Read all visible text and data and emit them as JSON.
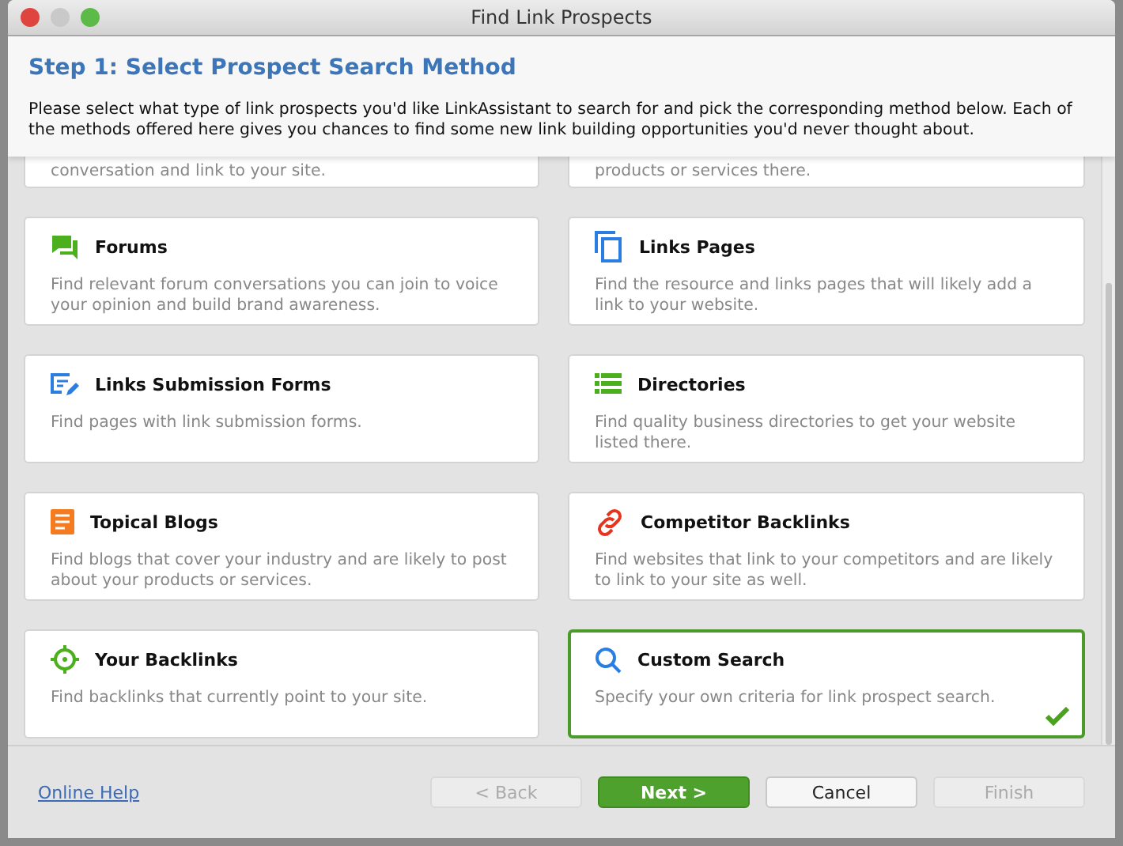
{
  "window": {
    "title": "Find Link Prospects"
  },
  "header": {
    "title": "Step 1: Select Prospect Search Method",
    "description": "Please select what type of link prospects you'd like LinkAssistant to search for and pick the corresponding method below. Each of the methods offered here gives you chances to find some new link building opportunities you'd never thought about."
  },
  "partial_cards": [
    "conversation and link to your site.",
    "products or services there."
  ],
  "methods": [
    {
      "kind": "forum",
      "title": "Forums",
      "description": "Find relevant forum conversations you can join to voice your opinion and build brand awareness.",
      "selected": false
    },
    {
      "kind": "pages",
      "title": "Links Pages",
      "description": "Find the resource and links pages that will likely add a link to your website.",
      "selected": false
    },
    {
      "kind": "form",
      "title": "Links Submission Forms",
      "description": "Find pages with link submission forms.",
      "selected": false
    },
    {
      "kind": "list",
      "title": "Directories",
      "description": "Find quality business directories to get your website listed there.",
      "selected": false
    },
    {
      "kind": "blog",
      "title": "Topical Blogs",
      "description": "Find blogs that cover your industry and are likely to post about your products or services.",
      "selected": false
    },
    {
      "kind": "chain",
      "title": "Competitor Backlinks",
      "description": "Find websites that link to your competitors and are likely to link to your site as well.",
      "selected": false
    },
    {
      "kind": "target",
      "title": "Your Backlinks",
      "description": "Find backlinks that currently point to your site.",
      "selected": false
    },
    {
      "kind": "search",
      "title": "Custom Search",
      "description": "Specify your own criteria for link prospect search.",
      "selected": true
    }
  ],
  "footer": {
    "help_link": "Online Help",
    "buttons": [
      {
        "label": "< Back",
        "kind": "normal",
        "disabled": true
      },
      {
        "label": "Next >",
        "kind": "primary",
        "disabled": false
      },
      {
        "label": "Cancel",
        "kind": "normal",
        "disabled": false
      },
      {
        "label": "Finish",
        "kind": "normal",
        "disabled": true
      }
    ]
  }
}
